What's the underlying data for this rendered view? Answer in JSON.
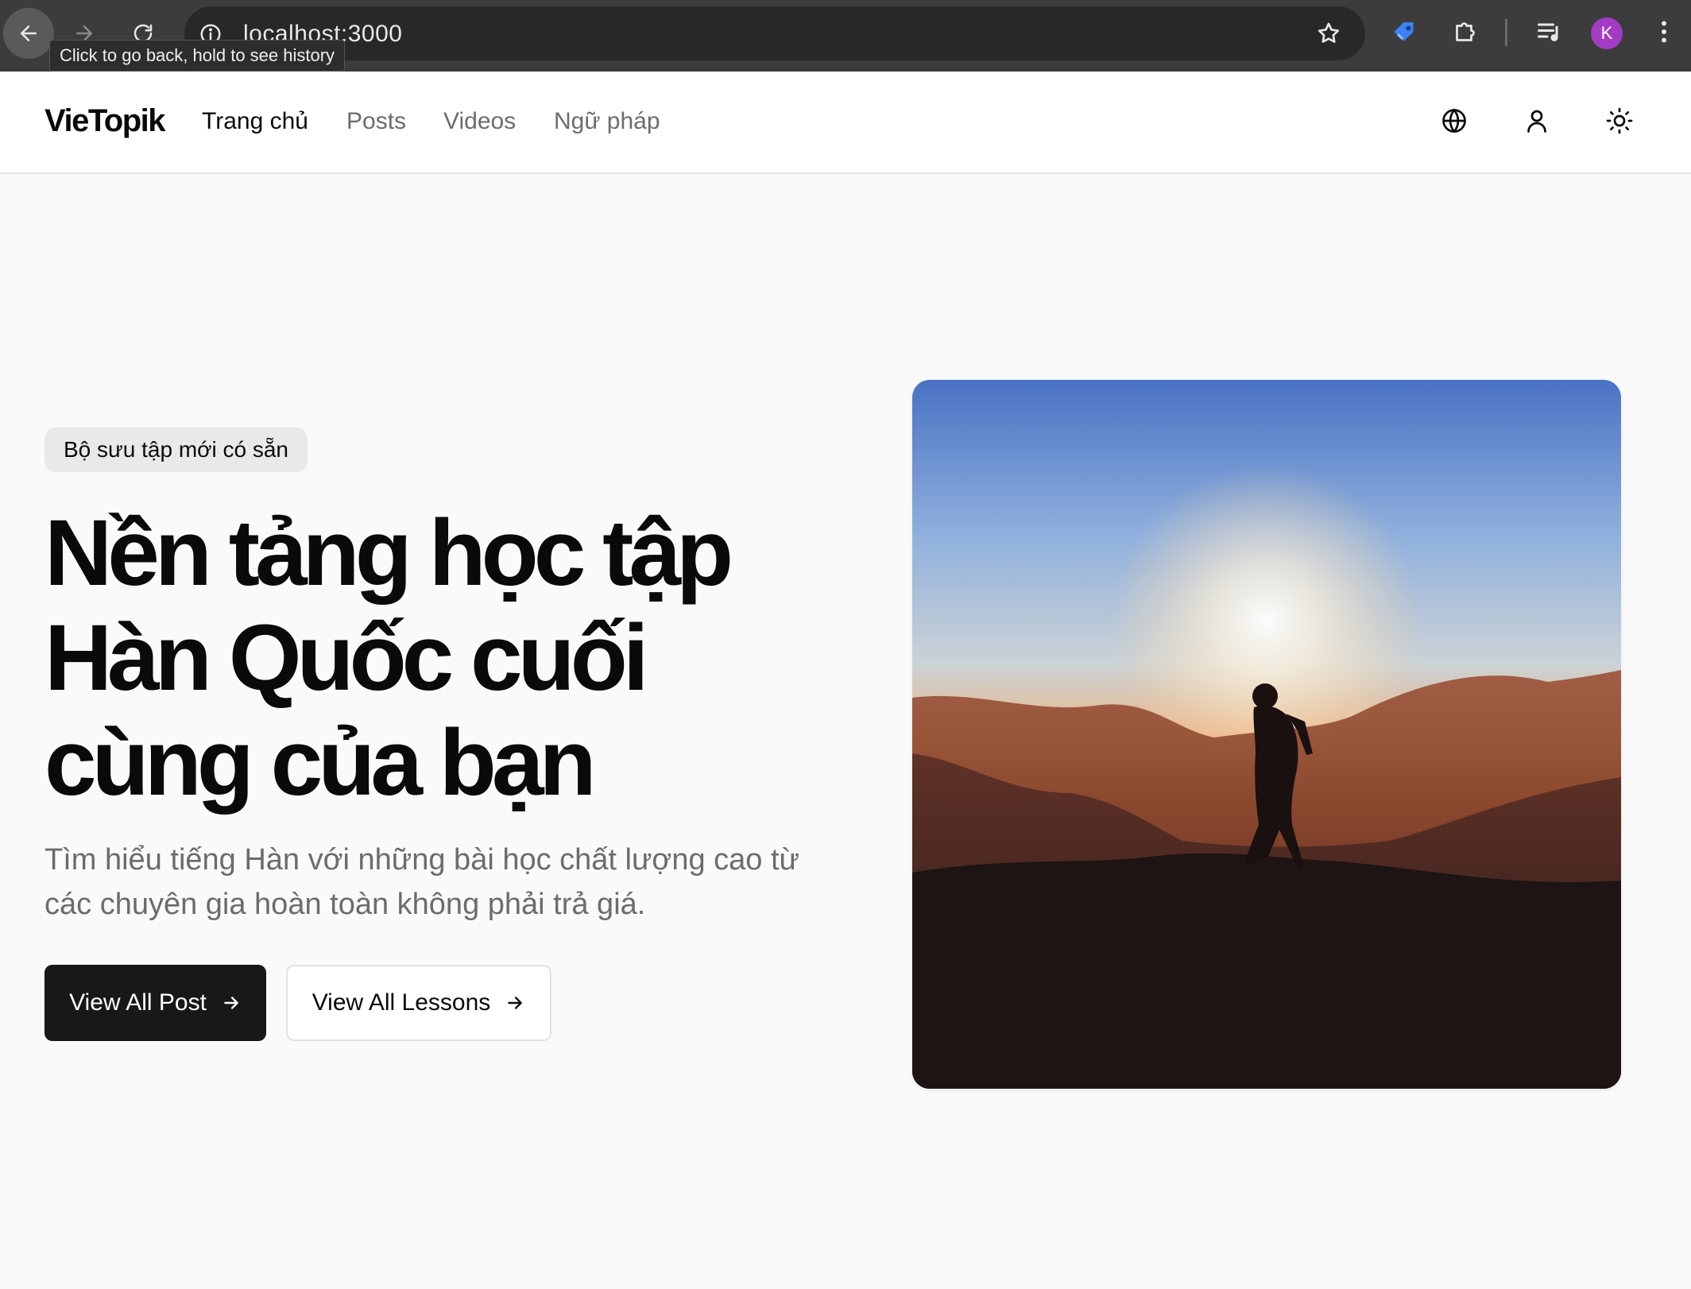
{
  "browser": {
    "url": "localhost:3000",
    "tooltip": "Click to go back, hold to see history",
    "profile_initial": "K"
  },
  "site": {
    "logo": "VieTopik",
    "nav": [
      {
        "label": "Trang chủ",
        "active": true
      },
      {
        "label": "Posts",
        "active": false
      },
      {
        "label": "Videos",
        "active": false
      },
      {
        "label": "Ngữ pháp",
        "active": false
      }
    ],
    "header_icons": [
      "globe-icon",
      "user-icon",
      "sun-icon"
    ]
  },
  "hero": {
    "badge": "Bộ sưu tập mới có sẵn",
    "title_lines": [
      "Nền tảng học tập",
      "Hàn Quốc cuối",
      "cùng của bạn"
    ],
    "subtitle_lines": [
      "Tìm hiểu tiếng Hàn với những bài học chất lượng cao từ",
      "các chuyên gia hoàn toàn không phải trả giá."
    ],
    "primary_button": "View All Post",
    "secondary_button": "View All Lessons",
    "image": "sunset-silhouette-photo"
  },
  "colors": {
    "primary": "#18181b",
    "muted_text": "#6b6b70",
    "background": "#fafafa",
    "badge_bg": "#e9e9e9"
  }
}
